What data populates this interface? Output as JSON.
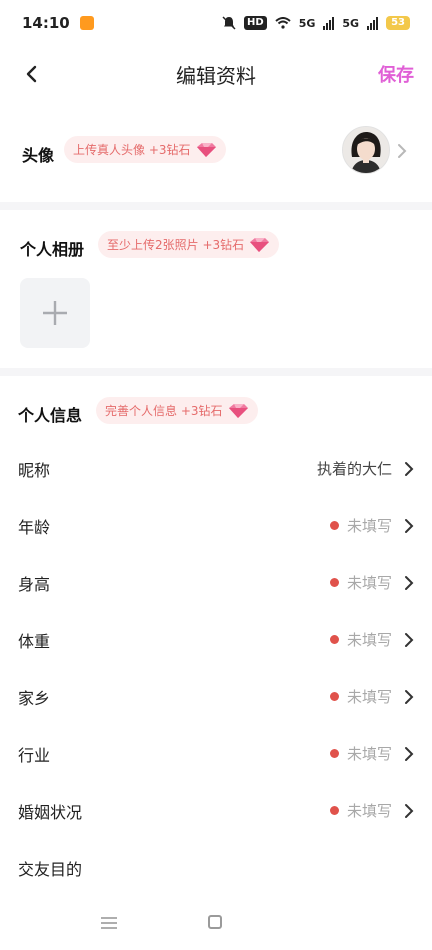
{
  "status_bar": {
    "time": "14:10",
    "hd": "HD",
    "network_1": "5G",
    "network_2": "5G",
    "battery": "53"
  },
  "nav": {
    "title": "编辑资料",
    "save_label": "保存",
    "accent_color": "#e05fd6"
  },
  "avatar_section": {
    "label": "头像",
    "reward": "上传真人头像 +3钻石"
  },
  "album_section": {
    "label": "个人相册",
    "reward": "至少上传2张照片 +3钻石"
  },
  "info_section": {
    "label": "个人信息",
    "reward": "完善个人信息 +3钻石",
    "rows": [
      {
        "label": "昵称",
        "value": "执着的大仁"
      },
      {
        "label": "年龄",
        "value": "未填写"
      },
      {
        "label": "身高",
        "value": "未填写"
      },
      {
        "label": "体重",
        "value": "未填写"
      },
      {
        "label": "家乡",
        "value": "未填写"
      },
      {
        "label": "行业",
        "value": "未填写"
      },
      {
        "label": "婚姻状况",
        "value": "未填写"
      },
      {
        "label": "交友目的",
        "value": ""
      }
    ]
  },
  "icons": {
    "back": "back-arrow-icon",
    "chevron": "chevron-right-icon",
    "gem": "diamond-icon",
    "add": "plus-icon",
    "menu": "menu-icon",
    "home": "home-square-icon",
    "mute": "bell-off-icon",
    "wifi": "wifi-icon"
  }
}
